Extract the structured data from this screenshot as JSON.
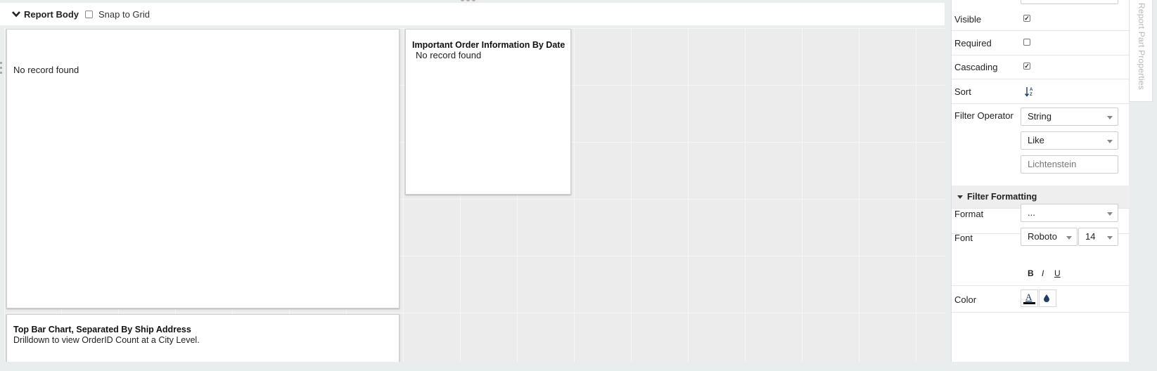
{
  "report_body": {
    "title": "Report Body",
    "snap_to_grid_label": "Snap to Grid",
    "snap_to_grid_checked": false
  },
  "parts": [
    {
      "title": "",
      "message": "No record found",
      "subtitle": ""
    },
    {
      "title": "Important Order Information By Date",
      "message": "No record found",
      "subtitle": ""
    },
    {
      "title": "Top Bar Chart, Separated By Ship Address",
      "message": "",
      "subtitle": "Drilldown to view OrderID Count at a City Level."
    }
  ],
  "properties": {
    "visible_label": "Visible",
    "visible_checked": true,
    "required_label": "Required",
    "required_checked": false,
    "cascading_label": "Cascading",
    "cascading_checked": true,
    "sort_label": "Sort",
    "sort_icon": "sort-ascending-icon",
    "filter_operator_label": "Filter Operator",
    "filter_type_value": "String",
    "filter_operator_value": "Like",
    "filter_value_placeholder": "Lichtenstein",
    "filter_formatting_title": "Filter Formatting",
    "format_label": "Format",
    "format_value": "...",
    "font_label": "Font",
    "font_family_value": "Roboto",
    "font_size_value": "14",
    "bold_label": "B",
    "italic_label": "I",
    "underline_label": "U",
    "color_label": "Color",
    "color_swatch": "#000000",
    "fill_color": "#1f3c66"
  },
  "side_tab": {
    "label": "Report Part Properties"
  }
}
